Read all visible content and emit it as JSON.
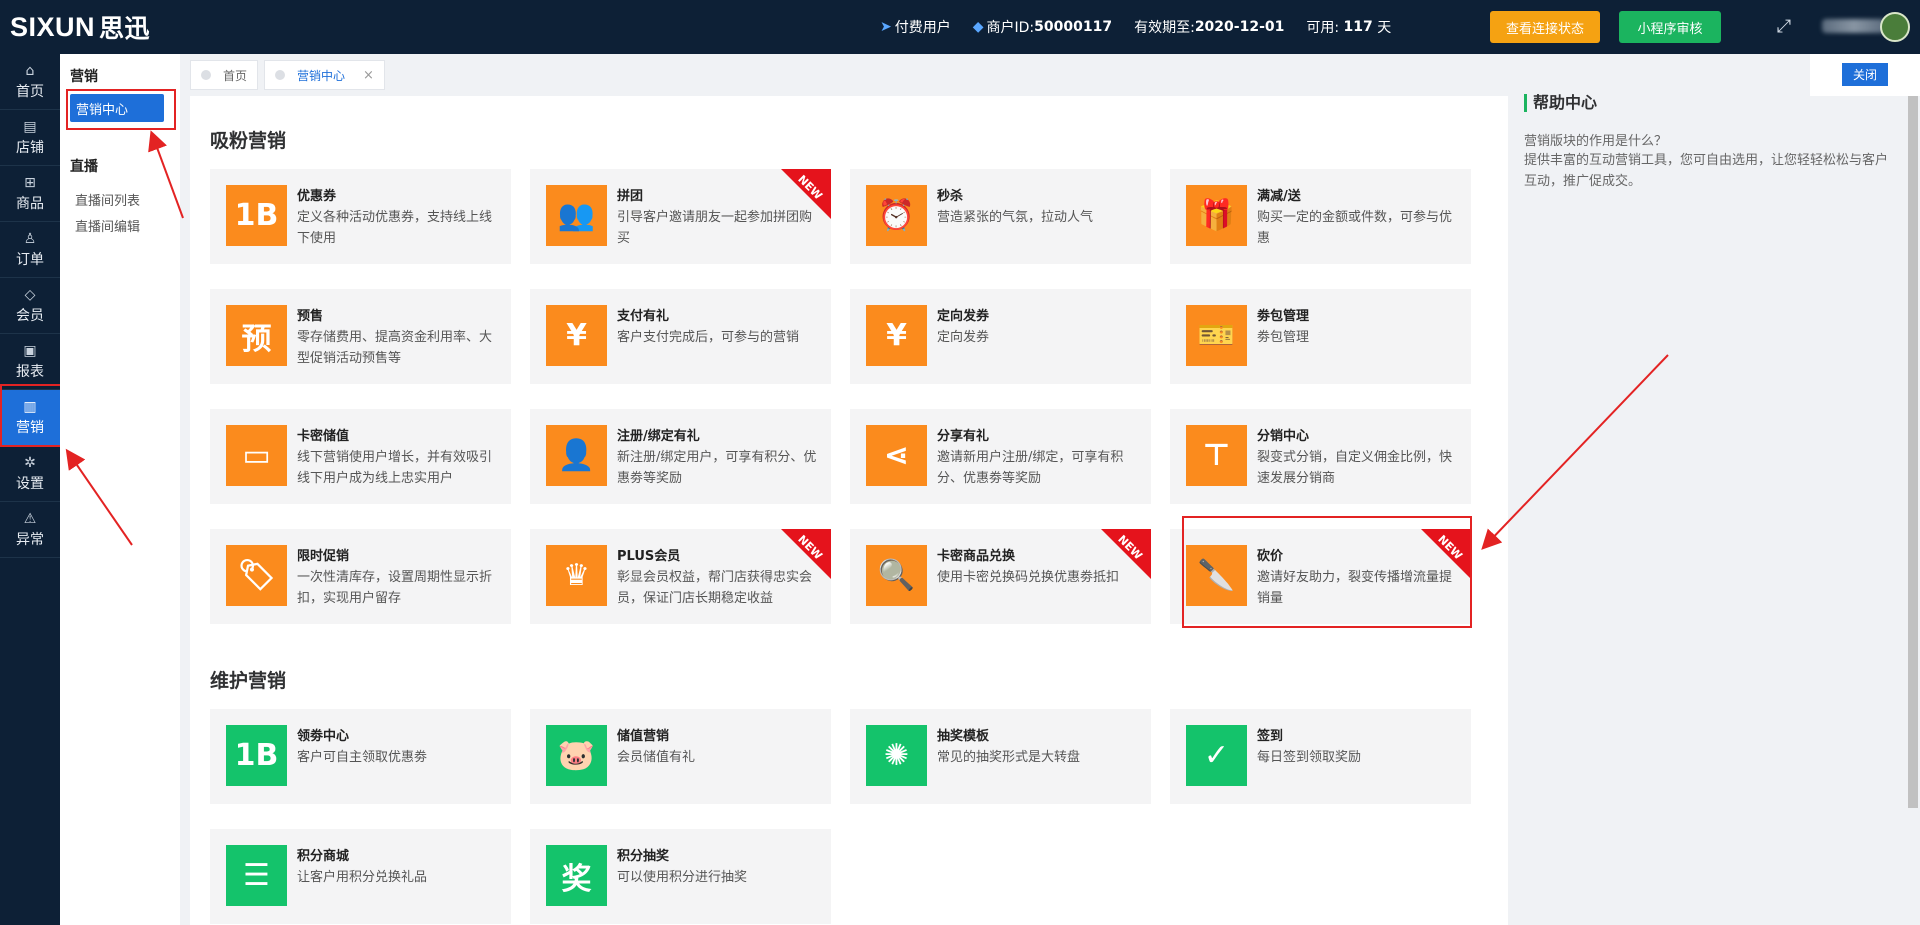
{
  "topbar": {
    "logo_en": "SIXUN",
    "logo_cn": "思迅",
    "paid_user": "付费用户",
    "merchant_label": "商户ID:",
    "merchant_id": "50000117",
    "valid_label": "有效期至:",
    "valid_date": "2020-12-01",
    "days_label": "可用:",
    "days_value": "117",
    "days_unit": "天",
    "btn_connection": "查看连接状态",
    "btn_miniapp": "小程序审核"
  },
  "sidenav": [
    {
      "label": "首页",
      "icon": "home-icon",
      "glyph": "⌂"
    },
    {
      "label": "店铺",
      "icon": "store-icon",
      "glyph": "▤"
    },
    {
      "label": "商品",
      "icon": "goods-icon",
      "glyph": "⊞"
    },
    {
      "label": "订单",
      "icon": "order-icon",
      "glyph": "♙"
    },
    {
      "label": "会员",
      "icon": "member-icon",
      "glyph": "◇"
    },
    {
      "label": "报表",
      "icon": "report-icon",
      "glyph": "▣"
    },
    {
      "label": "营销",
      "icon": "marketing-icon",
      "glyph": "▥"
    },
    {
      "label": "设置",
      "icon": "settings-icon",
      "glyph": "✲"
    },
    {
      "label": "异常",
      "icon": "warning-icon",
      "glyph": "⚠"
    }
  ],
  "subnav": {
    "marketing_title": "营销",
    "marketing_center": "营销中心",
    "live_title": "直播",
    "live_list": "直播间列表",
    "live_edit": "直播间编辑"
  },
  "tabs": {
    "home": "首页",
    "marketing_center": "营销中心",
    "close": "×"
  },
  "sections": {
    "fans": "吸粉营销",
    "maintain": "维护营销"
  },
  "cards": [
    {
      "title": "优惠券",
      "desc": "定义各种活动优惠券，支持线上线下使用",
      "glyph": "1B",
      "icon": "coupon-icon"
    },
    {
      "title": "拼团",
      "desc": "引导客户邀请朋友一起参加拼团购买",
      "glyph": "👥",
      "icon": "group-buy-icon",
      "badge": "NEW"
    },
    {
      "title": "秒杀",
      "desc": "营造紧张的气氛，拉动人气",
      "glyph": "⏰",
      "icon": "alarm-clock-icon"
    },
    {
      "title": "满减/送",
      "desc": "购买一定的金额或件数，可参与优惠",
      "glyph": "🎁",
      "icon": "gift-icon"
    },
    {
      "title": "预售",
      "desc": "零存储费用、提高资金利用率、大型促销活动预售等",
      "glyph": "预",
      "icon": "presale-icon"
    },
    {
      "title": "支付有礼",
      "desc": "客户支付完成后，可参与的营销",
      "glyph": "¥",
      "icon": "pay-gift-icon"
    },
    {
      "title": "定向发券",
      "desc": "定向发券",
      "glyph": "¥",
      "icon": "targeted-coupon-icon"
    },
    {
      "title": "劵包管理",
      "desc": "劵包管理",
      "glyph": "🎫",
      "icon": "coupon-pack-icon"
    },
    {
      "title": "卡密储值",
      "desc": "线下营销使用户增长，并有效吸引线下用户成为线上忠实用户",
      "glyph": "▭",
      "icon": "card-icon"
    },
    {
      "title": "注册/绑定有礼",
      "desc": "新注册/绑定用户，可享有积分、优惠劵等奖励",
      "glyph": "👤",
      "icon": "register-icon"
    },
    {
      "title": "分享有礼",
      "desc": "邀请新用户注册/绑定，可享有积分、优惠劵等奖励",
      "glyph": "⋖",
      "icon": "share-icon"
    },
    {
      "title": "分销中心",
      "desc": "裂变式分销，自定义佣金比例，快速发展分销商",
      "glyph": "⊤",
      "icon": "distribution-icon"
    },
    {
      "title": "限时促销",
      "desc": "一次性清库存，设置周期性显示折扣，实现用户留存",
      "glyph": "🏷",
      "icon": "tag-icon"
    },
    {
      "title": "PLUS会员",
      "desc": "彰显会员权益，帮门店获得忠实会员，保证门店长期稳定收益",
      "glyph": "♛",
      "icon": "crown-icon",
      "badge": "NEW"
    },
    {
      "title": "卡密商品兑换",
      "desc": "使用卡密兑换码兑换优惠劵抵扣",
      "glyph": "🔍",
      "icon": "card-exchange-icon",
      "badge": "NEW"
    },
    {
      "title": "砍价",
      "desc": "邀请好友助力，裂变传播增流量提销量",
      "glyph": "🔪",
      "icon": "cleaver-icon",
      "badge": "NEW"
    }
  ],
  "maintain_cards": [
    {
      "title": "领劵中心",
      "desc": "客户可自主领取优惠劵",
      "glyph": "1B",
      "icon": "coupon-center-icon"
    },
    {
      "title": "储值营销",
      "desc": "会员储值有礼",
      "glyph": "🐷",
      "icon": "piggy-bank-icon"
    },
    {
      "title": "抽奖模板",
      "desc": "常见的抽奖形式是大转盘",
      "glyph": "✺",
      "icon": "wheel-icon"
    },
    {
      "title": "签到",
      "desc": "每日签到领取奖励",
      "glyph": "✓",
      "icon": "checkin-icon"
    },
    {
      "title": "积分商城",
      "desc": "让客户用积分兑换礼品",
      "glyph": "☰",
      "icon": "points-mall-icon"
    },
    {
      "title": "积分抽奖",
      "desc": "可以使用积分进行抽奖",
      "glyph": "奖",
      "icon": "points-lottery-icon"
    }
  ],
  "help": {
    "close": "关闭",
    "title": "帮助中心",
    "question": "营销版块的作用是什么？",
    "answer": "提供丰富的互动营销工具，您可自由选用，让您轻轻松松与客户互动，推广促成交。"
  },
  "colors": {
    "nav_bg": "#0d2036",
    "active_blue": "#1e6fd9",
    "card_orange": "#fb8b1d",
    "card_green": "#14c36b",
    "ribbon_red": "#e5131c",
    "annotation_red": "#e32323"
  }
}
